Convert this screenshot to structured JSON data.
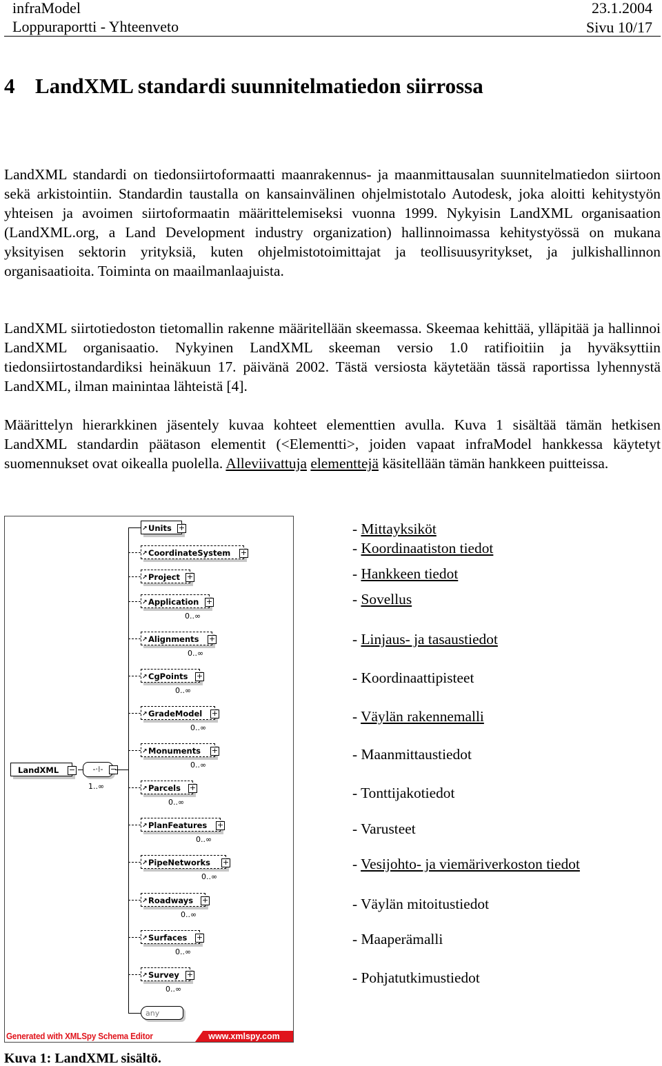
{
  "header": {
    "left_top": "infraModel",
    "left_bottom": "Loppuraportti - Yhteenveto",
    "right_top": "23.1.2004",
    "right_bottom": "Sivu 10/17"
  },
  "heading": {
    "number": "4",
    "title": "LandXML standardi suunnitelmatiedon siirrossa"
  },
  "paragraphs": [
    "LandXML standardi on tiedonsiirtoformaatti maanrakennus- ja maanmittausalan suunnitelma­tiedon siirtoon sekä arkistointiin. Standardin taustalla on kansainvälinen ohjelmistotalo Autodesk, joka aloitti kehitystyön yhteisen ja avoimen siirtoformaatin määrittelemiseksi vuonna 1999. Nykyisin LandXML organisaation (LandXML.org, a Land Development industry organization) hallinnoimassa kehitystyössä on mukana yksityisen sektorin yrityksiä, kuten ohjelmistotoimittajat ja teollisuusyritykset, ja julkishallinnon organisaatioita. Toiminta on maailmanlaajuista.",
    "LandXML siirtotiedoston tietomallin rakenne määritellään skeemassa. Skeemaa kehittää, ylläpitää ja hallinnoi LandXML organisaatio. Nykyinen LandXML skeeman versio 1.0 ratifioitiin ja hyväksyttiin tiedonsiirtostandardiksi heinäkuun 17. päivänä 2002. Tästä versiosta käytetään tässä raportissa lyhennystä LandXML, ilman mainintaa lähteistä [4]."
  ],
  "paragraph3": {
    "before": "Määrittelyn hierarkkinen jäsentely kuvaa kohteet elementtien avulla. Kuva 1 sisältää tämän hetkisen LandXML standardin päätason elementit (<Elementti>, joiden vapaat infraModel hankkessa käytetyt suomennukset ovat oikealla puolella. ",
    "underlined1": "Alleviivattuja",
    "space": " ",
    "underlined2": "elementtejä",
    "after": " käsitellään tämän hankkeen puitteissa."
  },
  "diagram": {
    "root": "LandXML",
    "root_cardinality": "1..∞",
    "elements": [
      {
        "name": "Units",
        "cardinality": "",
        "optional": false
      },
      {
        "name": "CoordinateSystem",
        "cardinality": "",
        "optional": true
      },
      {
        "name": "Project",
        "cardinality": "",
        "optional": true
      },
      {
        "name": "Application",
        "cardinality": "0..∞",
        "optional": true
      },
      {
        "name": "Alignments",
        "cardinality": "0..∞",
        "optional": true
      },
      {
        "name": "CgPoints",
        "cardinality": "0..∞",
        "optional": true
      },
      {
        "name": "GradeModel",
        "cardinality": "0..∞",
        "optional": true
      },
      {
        "name": "Monuments",
        "cardinality": "0..∞",
        "optional": true
      },
      {
        "name": "Parcels",
        "cardinality": "0..∞",
        "optional": true
      },
      {
        "name": "PlanFeatures",
        "cardinality": "0..∞",
        "optional": true
      },
      {
        "name": "PipeNetworks",
        "cardinality": "0..∞",
        "optional": true
      },
      {
        "name": "Roadways",
        "cardinality": "0..∞",
        "optional": true
      },
      {
        "name": "Surfaces",
        "cardinality": "0..∞",
        "optional": true
      },
      {
        "name": "Survey",
        "cardinality": "0..∞",
        "optional": true
      }
    ],
    "any": "any",
    "generated": "Generated with XMLSpy Schema Editor",
    "website": "www.xmlspy.com",
    "accent_color": "#e0141c"
  },
  "translations": [
    {
      "text": "Mittayksiköt",
      "underlined": true
    },
    {
      "text": "Koordinaatiston tiedot",
      "underlined": true
    },
    {
      "text": "Hankkeen tiedot",
      "underlined": true
    },
    {
      "text": "Sovellus",
      "underlined": true
    },
    {
      "text": "Linjaus- ja tasaustiedot",
      "underlined": true
    },
    {
      "text": "Koordinaattipisteet",
      "underlined": false
    },
    {
      "text": "Väylän rakennemalli",
      "underlined": true
    },
    {
      "text": "Maanmittaustiedot",
      "underlined": false
    },
    {
      "text": "Tonttijakotiedot",
      "underlined": false
    },
    {
      "text": "Varusteet",
      "underlined": false
    },
    {
      "text": "Vesijohto- ja viemäriverkoston tiedot",
      "underlined": true
    },
    {
      "text": "Väylän mitoitustiedot",
      "underlined": false
    },
    {
      "text": "Maaperämalli",
      "underlined": false
    },
    {
      "text": "Pohjatutkimustiedot",
      "underlined": false
    }
  ],
  "caption": "Kuva 1: LandXML sisältö."
}
